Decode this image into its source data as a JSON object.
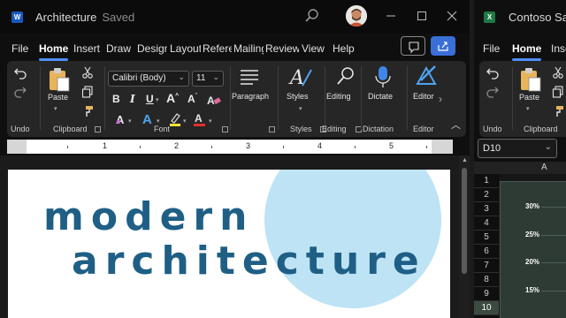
{
  "word": {
    "app_icon_letter": "W",
    "doc_name": "Architecture",
    "save_status": "Saved",
    "tabs": [
      "File",
      "Home",
      "Insert",
      "Draw",
      "Design",
      "Layout",
      "References",
      "Mailings",
      "Review",
      "View",
      "Help"
    ],
    "active_tab": "Home",
    "ribbon": {
      "undo_group": "Undo",
      "clipboard": {
        "paste_label": "Paste",
        "group_label": "Clipboard"
      },
      "font": {
        "font_name": "Calibri (Body)",
        "font_size": "11",
        "group_label": "Font"
      },
      "paragraph": {
        "button_label": "Paragraph"
      },
      "styles": {
        "button_label": "Styles",
        "group_label": "Styles"
      },
      "editing": {
        "button_label": "Editing",
        "group_label": "Editing"
      },
      "dictation": {
        "button_label": "Dictate",
        "group_label": "Dictation"
      },
      "editor": {
        "button_label": "Editor",
        "group_label": "Editor"
      }
    },
    "ruler_numbers": [
      "1",
      "2",
      "3",
      "4",
      "5"
    ],
    "document": {
      "heading_line1": "modern",
      "heading_line2": "architecture"
    }
  },
  "excel": {
    "app_icon_letter": "X",
    "workbook_name": "Contoso Sales",
    "tabs": [
      "File",
      "Home",
      "Insert"
    ],
    "active_tab": "Home",
    "ribbon": {
      "undo_group": "Undo",
      "paste_label": "Paste",
      "clipboard_group": "Clipboard"
    },
    "name_box": "D10",
    "column_header": "A",
    "row_numbers": [
      "1",
      "2",
      "3",
      "4",
      "5",
      "6",
      "7",
      "8",
      "9",
      "10"
    ],
    "selected_row": "10",
    "chart_axis_labels": [
      "30%",
      "25%",
      "20%",
      "15%"
    ]
  },
  "colors": {
    "word_accent": "#185abd",
    "excel_accent": "#1d7a45",
    "heading_text": "#1f5f86",
    "circle_fill": "#bde3f4",
    "share_button": "#3a6fd6"
  }
}
